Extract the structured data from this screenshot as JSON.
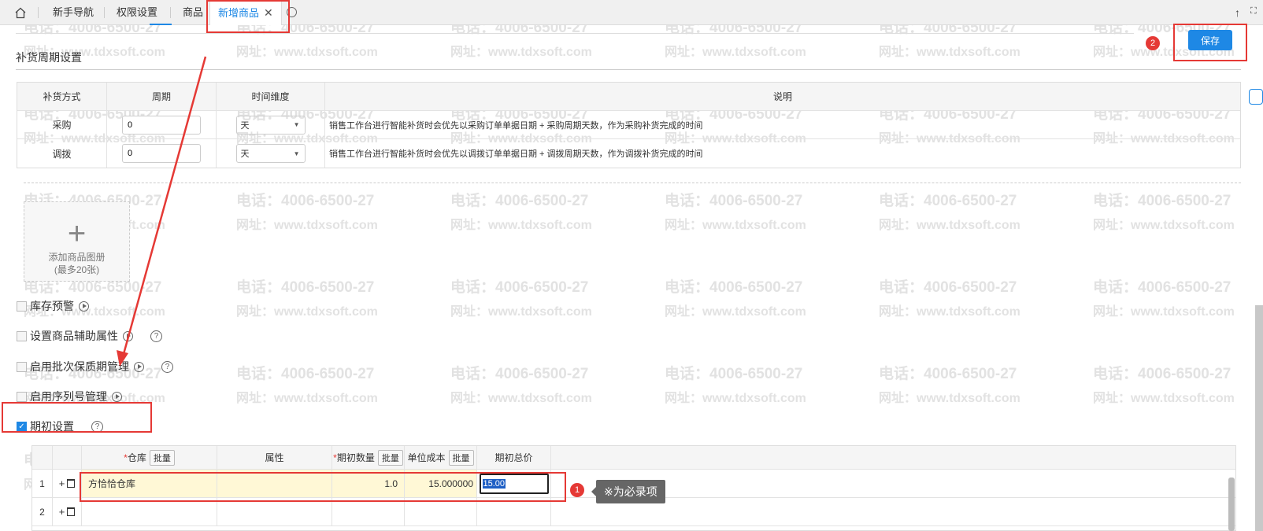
{
  "tabs": [
    {
      "label": "新手导航"
    },
    {
      "label": "权限设置"
    },
    {
      "label": "商品"
    },
    {
      "label": "新增商品",
      "active": true
    }
  ],
  "watermark": {
    "phone": "电话：4006-6500-27",
    "url": "网址：www.tdxsoft.com"
  },
  "save_label": "保存",
  "badges": {
    "save": "2",
    "row": "1"
  },
  "replenish": {
    "title": "补货周期设置",
    "headers": [
      "补货方式",
      "周期",
      "时间维度",
      "说明"
    ],
    "rows": [
      {
        "method": "采购",
        "period": "0",
        "unit": "天",
        "note": "销售工作台进行智能补货时会优先以采购订单单据日期 + 采购周期天数，作为采购补货完成的时间"
      },
      {
        "method": "调拨",
        "period": "0",
        "unit": "天",
        "note": "销售工作台进行智能补货时会优先以调拨订单单据日期 + 调拨周期天数，作为调拨补货完成的时间"
      }
    ]
  },
  "album": {
    "label": "添加商品图册",
    "limit": "(最多20张)"
  },
  "options": {
    "stock_alert": "库存预警",
    "aux_attr": "设置商品辅助属性",
    "batch_shelf": "启用批次保质期管理",
    "serial": "启用序列号管理",
    "opening": "期初设置"
  },
  "opening_table": {
    "required_mark": "*",
    "batch": "批量",
    "headers": {
      "warehouse": "仓库",
      "attr": "属性",
      "qty": "期初数量",
      "unit_cost": "单位成本",
      "total": "期初总价"
    },
    "rows": [
      {
        "no": "1",
        "warehouse": "方恰恰仓库",
        "qty": "1.0",
        "unit_cost": "15.000000",
        "total": "15.00"
      },
      {
        "no": "2"
      }
    ]
  },
  "tooltip": "※为必录项",
  "colors": {
    "accent": "#1e88e5",
    "annotation": "#e53935",
    "row_highlight": "#fff8d6"
  }
}
